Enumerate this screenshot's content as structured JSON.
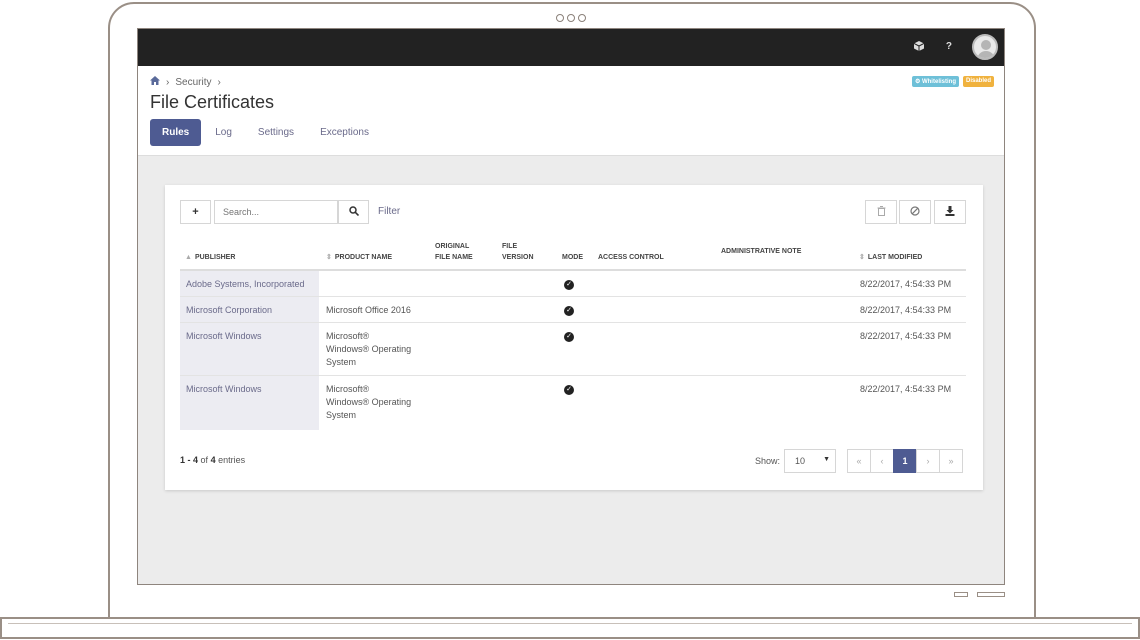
{
  "topbar": {
    "icons": [
      "cube-icon",
      "help-icon"
    ],
    "help_label": "?"
  },
  "breadcrumb": {
    "items": [
      "Security"
    ]
  },
  "page": {
    "title": "File Certificates"
  },
  "badges": {
    "whitelisting": "⚙ Whitelisting",
    "disabled": "Disabled"
  },
  "tabs": [
    "Rules",
    "Log",
    "Settings",
    "Exceptions"
  ],
  "toolbar": {
    "add_label": "+",
    "search_placeholder": "Search...",
    "filter_label": "Filter"
  },
  "table": {
    "columns": {
      "publisher": "PUBLISHER",
      "product_name": "PRODUCT NAME",
      "original_file_name_1": "ORIGINAL",
      "original_file_name_2": "FILE NAME",
      "file_version_1": "FILE",
      "file_version_2": "VERSION",
      "mode": "MODE",
      "access_control": "ACCESS CONTROL",
      "administrative_note": "ADMINISTRATIVE NOTE",
      "last_modified": "LAST MODIFIED"
    },
    "rows": [
      {
        "publisher": "Adobe Systems, Incorporated",
        "product_lines": [],
        "mode": true,
        "last_modified": "8/22/2017, 4:54:33 PM"
      },
      {
        "publisher": "Microsoft Corporation",
        "product_lines": [
          "Microsoft Office 2016"
        ],
        "mode": true,
        "last_modified": "8/22/2017, 4:54:33 PM"
      },
      {
        "publisher": "Microsoft Windows",
        "product_lines": [
          "Microsoft®",
          "Windows® Operating",
          "System"
        ],
        "mode": true,
        "last_modified": "8/22/2017, 4:54:33 PM"
      },
      {
        "publisher": "Microsoft Windows",
        "product_lines": [
          "Microsoft®",
          "Windows® Operating",
          "System"
        ],
        "mode": true,
        "last_modified": "8/22/2017, 4:54:33 PM"
      }
    ]
  },
  "footer": {
    "range": "1 - 4",
    "of_label": "of",
    "total": "4",
    "entries_label": "entries",
    "show_label": "Show:",
    "page_size": "10",
    "pager": {
      "first": "«",
      "prev": "‹",
      "current": "1",
      "next": "›",
      "last": "»"
    }
  }
}
